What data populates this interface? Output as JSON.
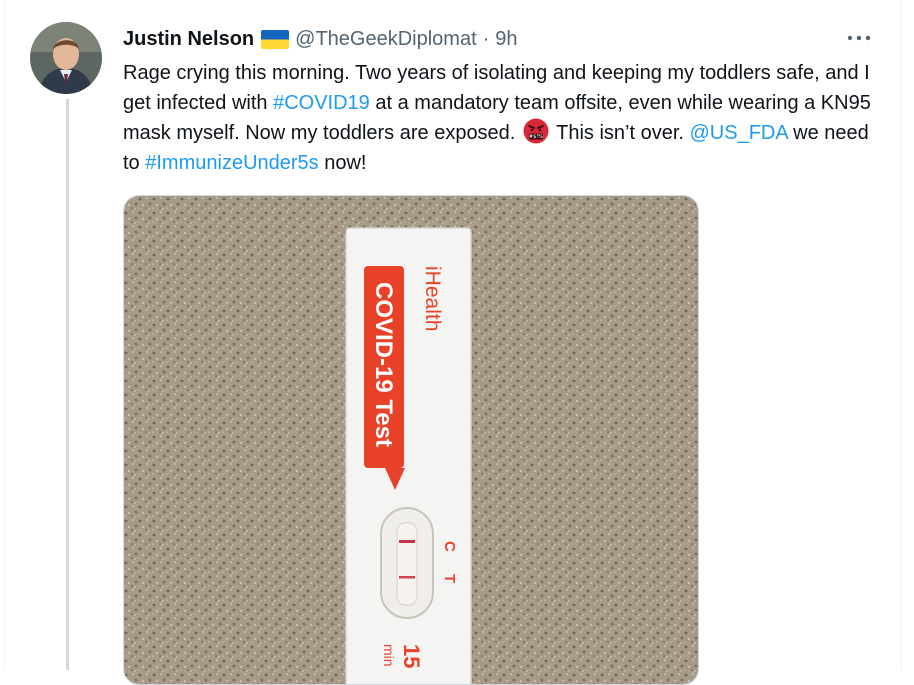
{
  "tweet": {
    "author_name": "Justin Nelson",
    "flag_icon": "ukraine-flag-icon",
    "handle": "@TheGeekDiplomat",
    "separator": "·",
    "time": "9h",
    "more_icon": "more-horizontal-icon",
    "text_parts": {
      "p1": "Rage crying this morning. Two years of isolating and keeping my toddlers safe, and I get infected with ",
      "hashtag1": "#COVID19",
      "p2": " at a mandatory team offsite, even while wearing a KN95 mask myself. Now my toddlers are exposed. ",
      "emoji_icon": "angry-face-with-symbols-emoji",
      "p3": " This isn’t over. ",
      "mention": "@US_FDA",
      "p4": " we need to ",
      "hashtag2": "#ImmunizeUnder5s",
      "p5": " now!"
    }
  },
  "media": {
    "brand": "iHealth",
    "product": "COVID-19 Test",
    "label_c": "C",
    "label_t": "T",
    "timer_number": "15",
    "timer_unit": "min"
  },
  "colors": {
    "link": "#1d9bf0",
    "secondary_text": "#536471",
    "test_red": "#e8432a",
    "counter": "#a79a88"
  }
}
